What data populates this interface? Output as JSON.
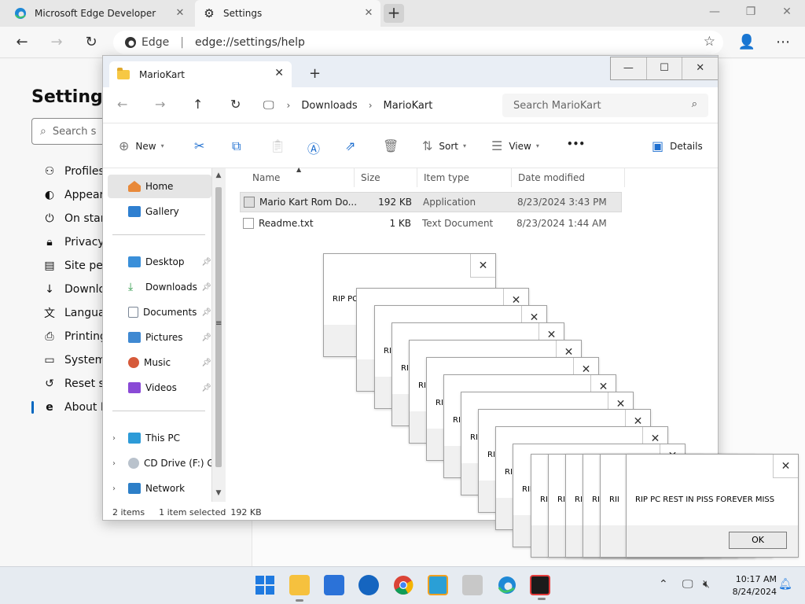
{
  "edge": {
    "tabs": [
      {
        "label": "Microsoft Edge Developer"
      },
      {
        "label": "Settings"
      }
    ],
    "new_tab_label": "+",
    "address": {
      "brand": "Edge",
      "url": "edge://settings/help"
    },
    "window": {
      "minimize": "—",
      "restore": "❐",
      "close": "✕"
    }
  },
  "settings": {
    "title": "Settings",
    "search_placeholder": "Search s",
    "nav": [
      {
        "label": "Profiles",
        "icon": "person-icon"
      },
      {
        "label": "Appeara",
        "icon": "palette-icon"
      },
      {
        "label": "On start",
        "icon": "power-icon"
      },
      {
        "label": "Privacy ,",
        "icon": "lock-icon"
      },
      {
        "label": "Site perr",
        "icon": "site-permissions-icon"
      },
      {
        "label": "Downlo",
        "icon": "download-icon"
      },
      {
        "label": "Languag",
        "icon": "language-icon"
      },
      {
        "label": "Printing",
        "icon": "printer-icon"
      },
      {
        "label": "System",
        "icon": "laptop-icon"
      },
      {
        "label": "Reset se",
        "icon": "reset-icon"
      },
      {
        "label": "About M",
        "icon": "edge-logo-icon"
      }
    ]
  },
  "explorer": {
    "tab_title": "MarioKart",
    "window": {
      "minimize": "—",
      "maximize": "☐",
      "close": "✕"
    },
    "breadcrumb": [
      "Downloads",
      "MarioKart"
    ],
    "search_placeholder": "Search MarioKart",
    "commands": {
      "new": "New",
      "sort": "Sort",
      "view": "View",
      "more": "•••",
      "details": "Details"
    },
    "sidebar": {
      "home": "Home",
      "gallery": "Gallery",
      "quick_access": [
        {
          "label": "Desktop",
          "color": "#3a8fd9"
        },
        {
          "label": "Downloads",
          "color": "#2f9a4a"
        },
        {
          "label": "Documents",
          "color": "#7a8696"
        },
        {
          "label": "Pictures",
          "color": "#3f89d2"
        },
        {
          "label": "Music",
          "color": "#d65a3a"
        },
        {
          "label": "Videos",
          "color": "#8a4ad6"
        }
      ],
      "locations": [
        {
          "label": "This PC"
        },
        {
          "label": "CD Drive (F:) GS"
        },
        {
          "label": "Network"
        }
      ]
    },
    "columns": [
      "Name",
      "Size",
      "Item type",
      "Date modified"
    ],
    "files": [
      {
        "name": "Mario Kart Rom Do...",
        "size": "192 KB",
        "type": "Application",
        "date": "8/23/2024 3:43 PM"
      },
      {
        "name": "Readme.txt",
        "size": "1 KB",
        "type": "Text Document",
        "date": "8/23/2024 1:44 AM"
      }
    ],
    "status": {
      "count": "2 items",
      "selected": "1 item selected",
      "size": "192 KB"
    }
  },
  "dialog": {
    "message": "RIP PC REST IN PISS FOREVER MISS",
    "partial_message": "RII",
    "close": "✕",
    "ok": "OK"
  },
  "taskbar": {
    "time": "10:17 AM",
    "date": "8/24/2024"
  }
}
